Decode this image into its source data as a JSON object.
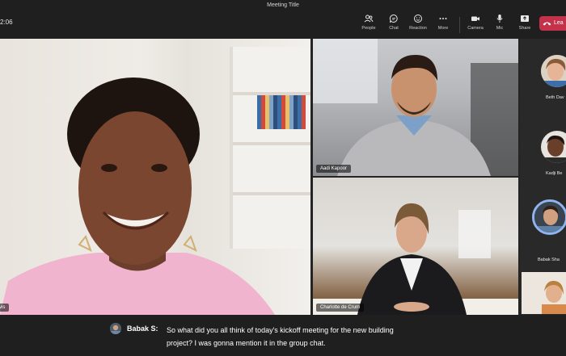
{
  "window": {
    "title": "Meeting Title"
  },
  "toolbar": {
    "timer": "2:06",
    "items": [
      {
        "label": "People",
        "icon": "people-icon"
      },
      {
        "label": "Chat",
        "icon": "chat-icon"
      },
      {
        "label": "Reaction",
        "icon": "reaction-icon"
      },
      {
        "label": "More",
        "icon": "more-icon"
      },
      {
        "label": "Camera",
        "icon": "camera-icon"
      },
      {
        "label": "Mic",
        "icon": "mic-icon"
      },
      {
        "label": "Share",
        "icon": "share-icon"
      }
    ],
    "leave_label": "Lea",
    "leave_color": "#c4314b"
  },
  "stage": {
    "main_tile": {
      "name_label": "vis"
    },
    "tiles": [
      {
        "name": "Aadi Kapoor"
      },
      {
        "name": "Charlotte de Crum"
      }
    ]
  },
  "roster": {
    "items": [
      {
        "name": "Beth Dav"
      },
      {
        "name": "Kadji Be"
      },
      {
        "name": "Babak Sha"
      },
      {
        "name": ""
      }
    ]
  },
  "captions": {
    "speaker": "Babak S:",
    "line1": "So what did you all think of today's kickoff meeting for the new building",
    "line2": "project? I was gonna mention it in the group chat."
  },
  "colors": {
    "background": "#1f1f1f",
    "active_ring": "#8fb4ef"
  }
}
